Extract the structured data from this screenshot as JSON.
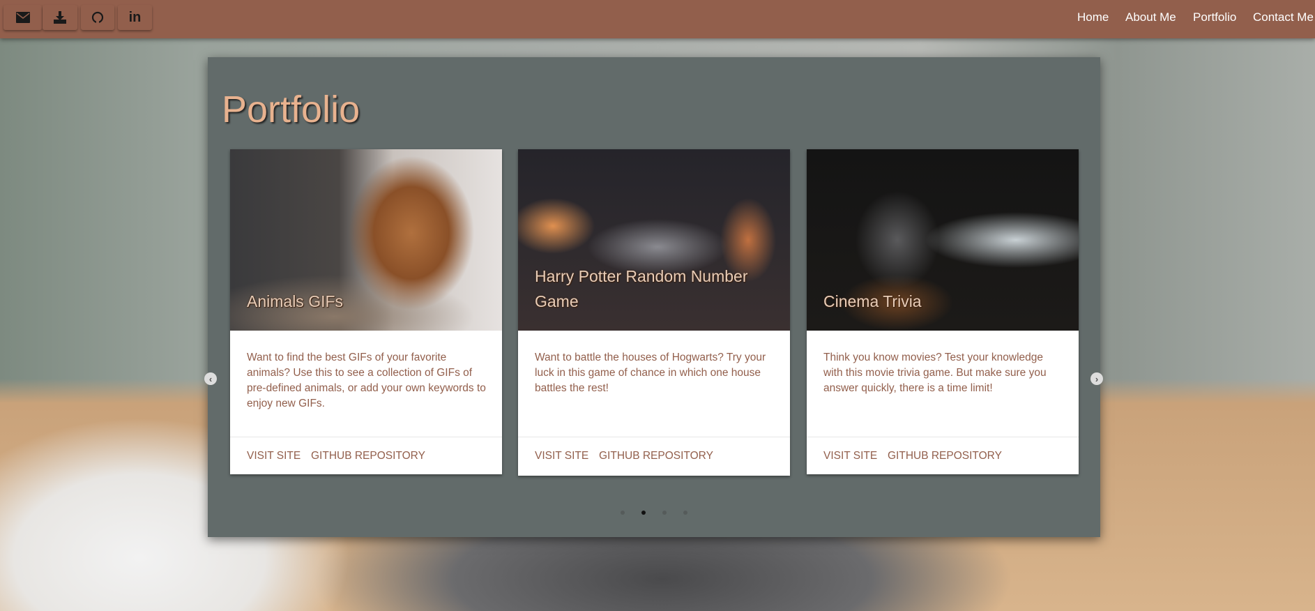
{
  "social_buttons": [
    {
      "icon": "envelope-icon"
    },
    {
      "icon": "download-icon"
    },
    {
      "icon": "github-icon"
    },
    {
      "icon": "linkedin-icon",
      "label": "in"
    }
  ],
  "nav": {
    "links": [
      "Home",
      "About Me",
      "Portfolio",
      "Contact Me"
    ]
  },
  "portfolio": {
    "title": "Portfolio",
    "cards": [
      {
        "title": "Animals GIFs",
        "description": "Want to find the best GIFs of your favorite animals? Use this to see a collection of GIFs of pre-defined animals, or add your own keywords to enjoy new GIFs.",
        "visit": "VISIT SITE",
        "repo": "GITHUB REPOSITORY"
      },
      {
        "title": "Harry Potter Random Number Game",
        "description": "Want to battle the houses of Hogwarts? Try your luck in this game of chance in which one house battles the rest!",
        "visit": "VISIT SITE",
        "repo": "GITHUB REPOSITORY"
      },
      {
        "title": "Cinema Trivia",
        "description": "Think you know movies? Test your knowledge with this movie trivia game. But make sure you answer quickly, there is a time limit!",
        "visit": "VISIT SITE",
        "repo": "GITHUB REPOSITORY"
      }
    ],
    "carousel": {
      "page_count": 4,
      "active_index": 1
    }
  },
  "colors": {
    "nav": "#925f4c",
    "panel": "#626b6a",
    "title": "#e8b28f"
  }
}
